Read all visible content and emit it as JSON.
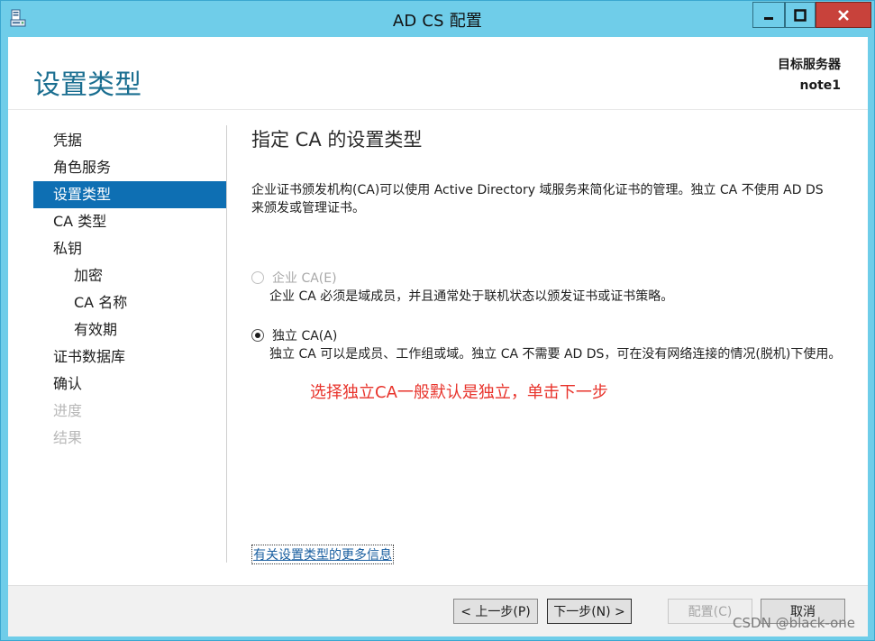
{
  "window": {
    "title": "AD CS 配置",
    "controls": {
      "minimize": "minimize",
      "maximize": "maximize",
      "close": "close"
    },
    "accent": "#6fcde9",
    "close_color": "#c8423b"
  },
  "header": {
    "title": "设置类型",
    "target_label": "目标服务器",
    "target_name": "note1"
  },
  "nav": {
    "items": [
      {
        "label": "凭据",
        "state": "normal"
      },
      {
        "label": "角色服务",
        "state": "normal"
      },
      {
        "label": "设置类型",
        "state": "active"
      },
      {
        "label": "CA 类型",
        "state": "normal"
      },
      {
        "label": "私钥",
        "state": "normal"
      },
      {
        "label": "加密",
        "state": "sub"
      },
      {
        "label": "CA 名称",
        "state": "sub"
      },
      {
        "label": "有效期",
        "state": "sub"
      },
      {
        "label": "证书数据库",
        "state": "normal"
      },
      {
        "label": "确认",
        "state": "normal"
      },
      {
        "label": "进度",
        "state": "disabled"
      },
      {
        "label": "结果",
        "state": "disabled"
      }
    ],
    "active_color": "#0e6fb3"
  },
  "content": {
    "heading": "指定 CA 的设置类型",
    "description": "企业证书颁发机构(CA)可以使用 Active Directory 域服务来简化证书的管理。独立 CA 不使用 AD DS 来颁发或管理证书。",
    "options": {
      "enterprise": {
        "label": "企业 CA(E)",
        "description": "企业 CA 必须是域成员，并且通常处于联机状态以颁发证书或证书策略。",
        "selected": false,
        "enabled": false
      },
      "standalone": {
        "label": "独立 CA(A)",
        "description": "独立 CA 可以是成员、工作组或域。独立 CA 不需要 AD DS，可在没有网络连接的情况(脱机)下使用。",
        "selected": true,
        "enabled": true
      }
    },
    "annotation": "选择独立CA一般默认是独立，单击下一步",
    "annotation_color": "#e8332b",
    "more_info_link": "有关设置类型的更多信息"
  },
  "footer": {
    "prev_label": "< 上一步(P)",
    "next_label": "下一步(N) >",
    "configure_label": "配置(C)",
    "cancel_label": "取消"
  },
  "watermark": "CSDN @black-one"
}
